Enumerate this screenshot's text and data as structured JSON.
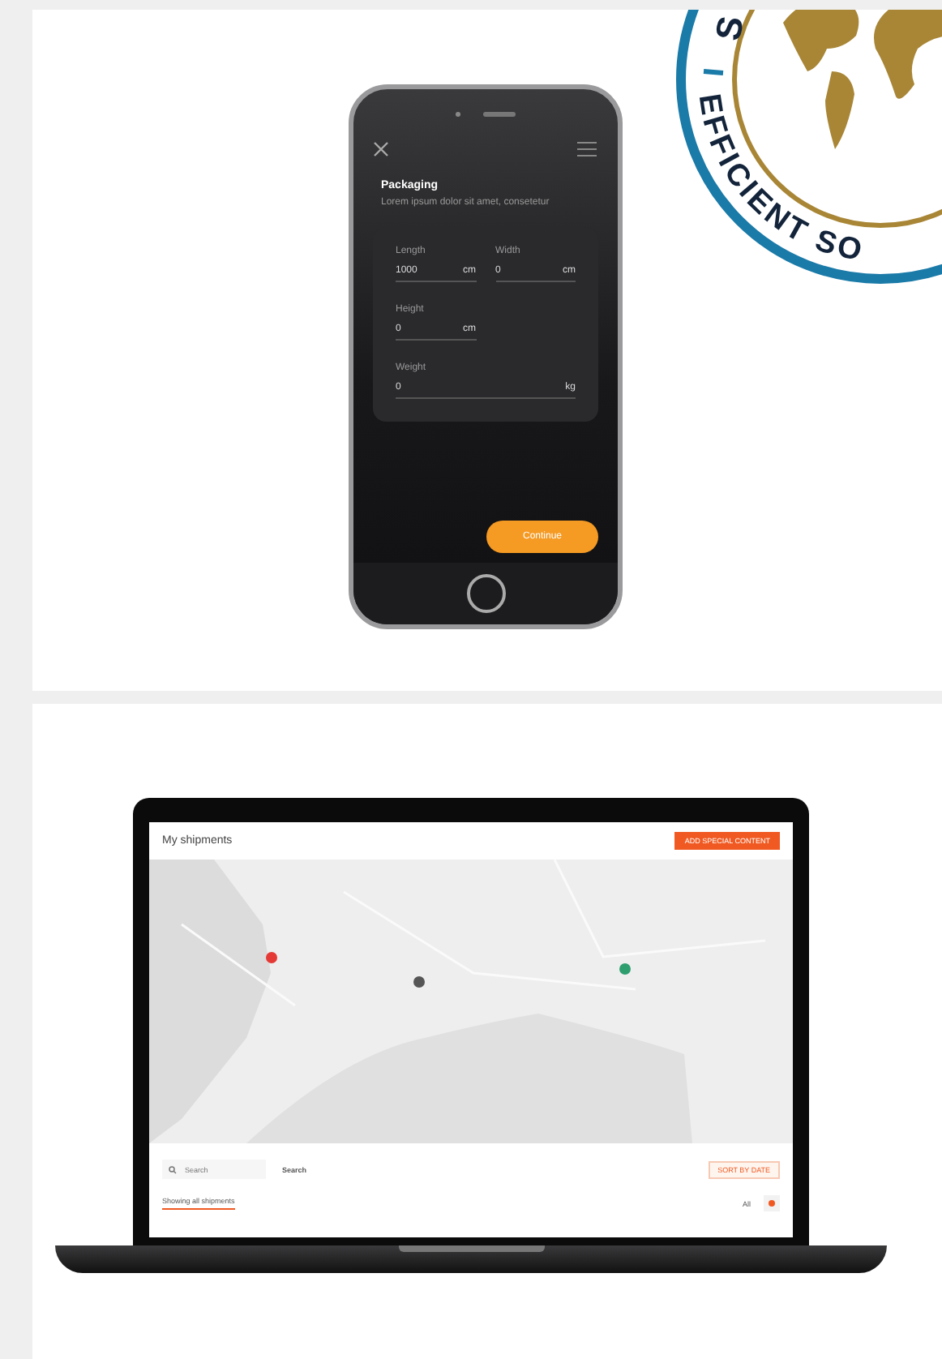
{
  "seal": {
    "text_top": "S",
    "text_bottom": "EFFICIENT SO"
  },
  "phone": {
    "title": "Packaging",
    "description": "Lorem ipsum dolor sit amet, consetetur",
    "fields": [
      {
        "kind": "half",
        "label": "Length",
        "value": "1000",
        "unit": "cm"
      },
      {
        "kind": "half",
        "label": "Width",
        "value": "0",
        "unit": "cm"
      },
      {
        "kind": "half",
        "label": "Height",
        "value": "0",
        "unit": "cm"
      },
      {
        "kind": "full",
        "label": "Weight",
        "value": "0",
        "unit": "kg"
      }
    ],
    "button": "Continue"
  },
  "laptop": {
    "title": "My shipments",
    "add_button": "ADD SPECIAL CONTENT",
    "markers": [
      {
        "color": "#e53935"
      },
      {
        "color": "#555555"
      },
      {
        "color": "#2e9e6e"
      }
    ],
    "search": {
      "placeholder": "Search"
    },
    "search_button": "Search",
    "filter_button": "SORT BY DATE",
    "tab": "Showing all shipments",
    "dropdown": "All"
  }
}
